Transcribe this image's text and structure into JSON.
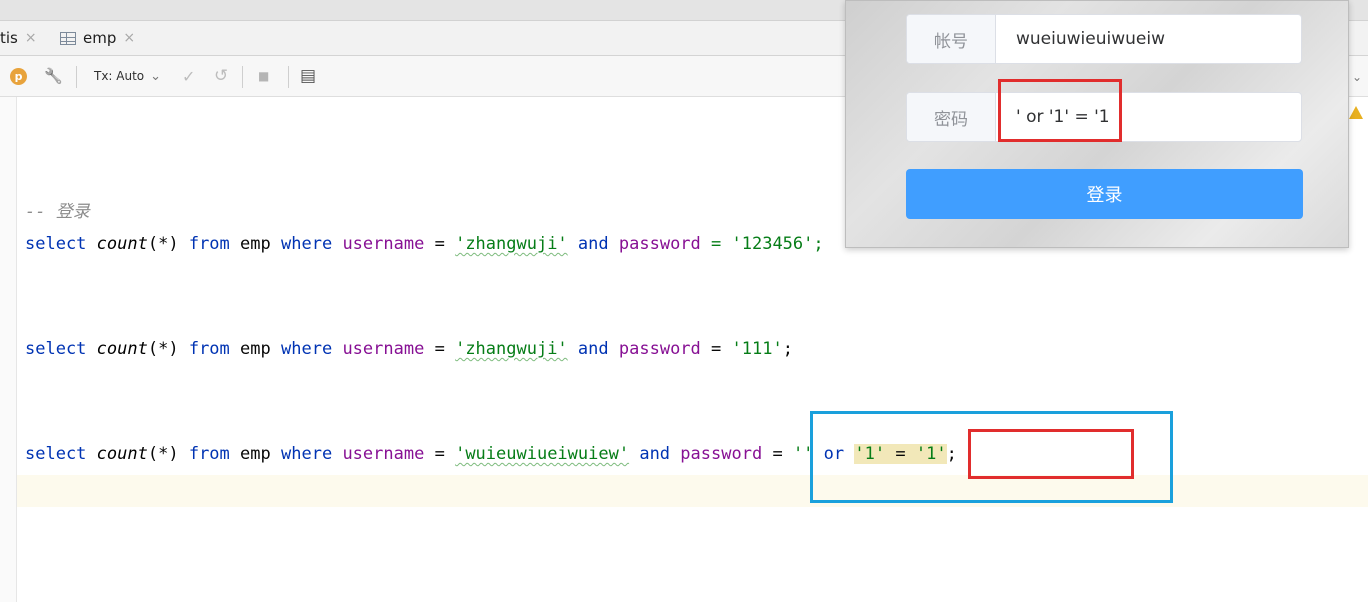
{
  "tabs": [
    {
      "label": "tis",
      "close": "×"
    },
    {
      "label": "emp",
      "close": "×"
    }
  ],
  "toolbar": {
    "p_badge": "p",
    "tx_label": "Tx: Auto",
    "tx_chevron": "⌄",
    "commit_glyph": "✓",
    "rollback_glyph": "↺",
    "stop_glyph": "■",
    "table_glyph": "▤",
    "wrench_glyph": "🔧"
  },
  "editor": {
    "comment": "-- 登录",
    "line1": {
      "select": "select",
      "count": "count",
      "paren": "(*)",
      "from": "from",
      "table": "emp",
      "where": "where",
      "column1": "username",
      "eq": "=",
      "user": "'zhangwuji'",
      "and": "and",
      "column2": "password",
      "tail_hidden": "= '123456';"
    },
    "line2": {
      "select": "select",
      "count": "count",
      "paren": "(*)",
      "from": "from",
      "table": "emp",
      "where": "where",
      "column1": "username",
      "eq": "=",
      "user": "'zhangwuji'",
      "and": "and",
      "column2": "password",
      "eq2": "=",
      "pass": "'111'",
      "semi": ";"
    },
    "line3": {
      "select": "select",
      "count": "count",
      "paren": "(*)",
      "from": "from",
      "table": "emp",
      "where": "where",
      "column1": "username",
      "eq": "=",
      "user": "'wuieuwiueiwuiew'",
      "and": "and",
      "column2": "password",
      "eq2": "=",
      "quote_open": "''",
      "or": "or",
      "lit1": "'1'",
      "eq3": "=",
      "lit2": "'1'",
      "semi": ";"
    }
  },
  "login": {
    "account_label": "帐号",
    "account_value": "wueiuwieuiwueiw",
    "password_label": "密码",
    "password_value": "' or '1' = '1",
    "login_button": "登录"
  },
  "colors": {
    "red_box": "#e12d2d",
    "blue_box": "#1aa0dc",
    "login_button": "#409eff"
  }
}
